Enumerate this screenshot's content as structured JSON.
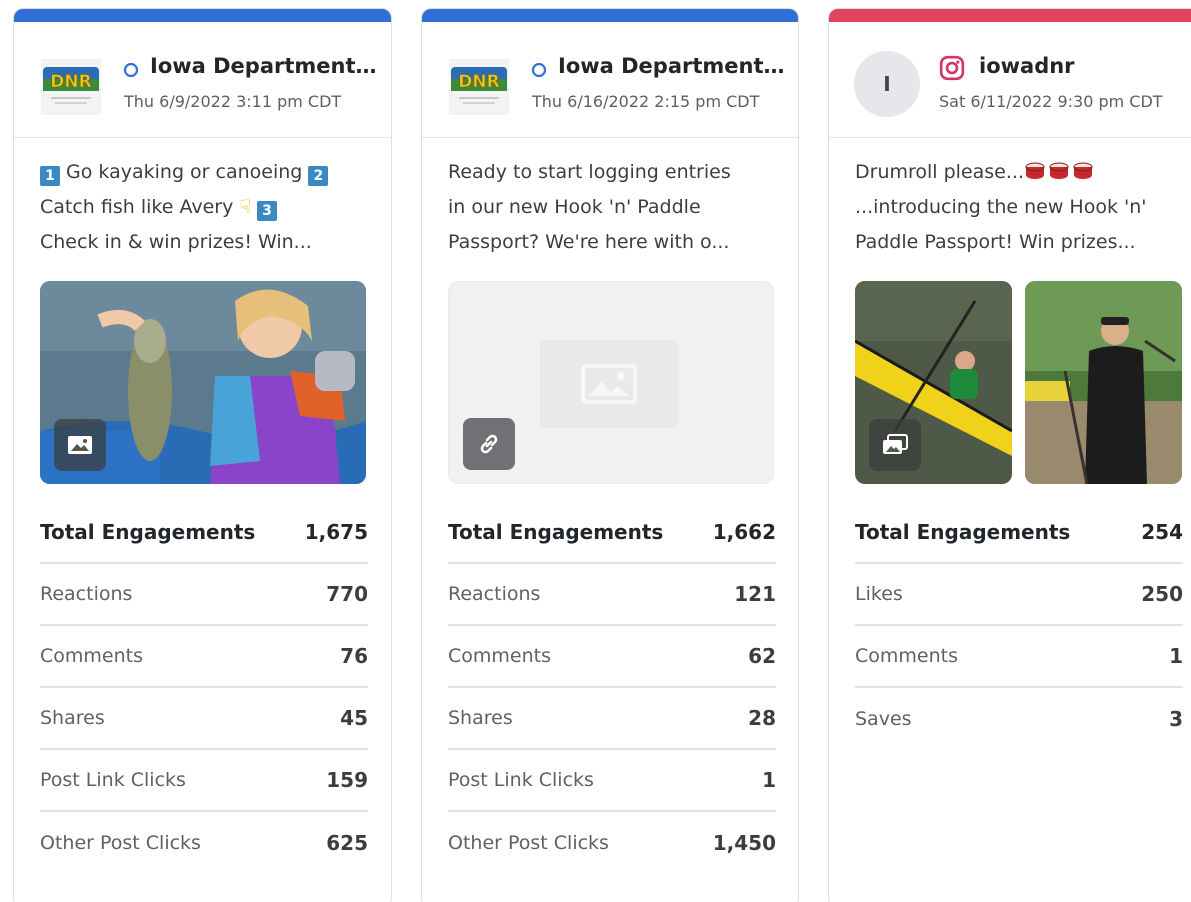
{
  "cards": [
    {
      "network": "facebook",
      "accent": "#2f6fd6",
      "author": "Iowa Department of Natural Resources",
      "date": "Thu 6/9/2022 3:11 pm CDT",
      "text_lines": [
        "Go kayaking or canoeing",
        "Catch fish like Avery",
        "Check in & win prizes! Win..."
      ],
      "text_keycaps": [
        "1",
        "2",
        "3"
      ],
      "media_type": "photo",
      "stats": [
        {
          "label": "Total Engagements",
          "value": "1,675"
        },
        {
          "label": "Reactions",
          "value": "770"
        },
        {
          "label": "Comments",
          "value": "76"
        },
        {
          "label": "Shares",
          "value": "45"
        },
        {
          "label": "Post Link Clicks",
          "value": "159"
        },
        {
          "label": "Other Post Clicks",
          "value": "625"
        }
      ]
    },
    {
      "network": "facebook",
      "accent": "#2f6fd6",
      "author": "Iowa Department of Natural Resources",
      "date": "Thu 6/16/2022 2:15 pm CDT",
      "text_lines": [
        "Ready to start logging entries",
        "in our new Hook 'n' Paddle",
        "Passport? We're here with o..."
      ],
      "media_type": "link",
      "stats": [
        {
          "label": "Total Engagements",
          "value": "1,662"
        },
        {
          "label": "Reactions",
          "value": "121"
        },
        {
          "label": "Comments",
          "value": "62"
        },
        {
          "label": "Shares",
          "value": "28"
        },
        {
          "label": "Post Link Clicks",
          "value": "1"
        },
        {
          "label": "Other Post Clicks",
          "value": "1,450"
        }
      ]
    },
    {
      "network": "instagram",
      "accent": "#e0435d",
      "author": "iowadnr",
      "avatar_letter": "I",
      "date": "Sat 6/11/2022 9:30 pm CDT",
      "text_lines": [
        "Drumroll please...",
        "...introducing the new Hook 'n'",
        "Paddle Passport! Win prizes..."
      ],
      "media_type": "carousel",
      "stats": [
        {
          "label": "Total Engagements",
          "value": "254"
        },
        {
          "label": "Likes",
          "value": "250"
        },
        {
          "label": "Comments",
          "value": "1"
        },
        {
          "label": "Saves",
          "value": "3"
        }
      ]
    }
  ]
}
